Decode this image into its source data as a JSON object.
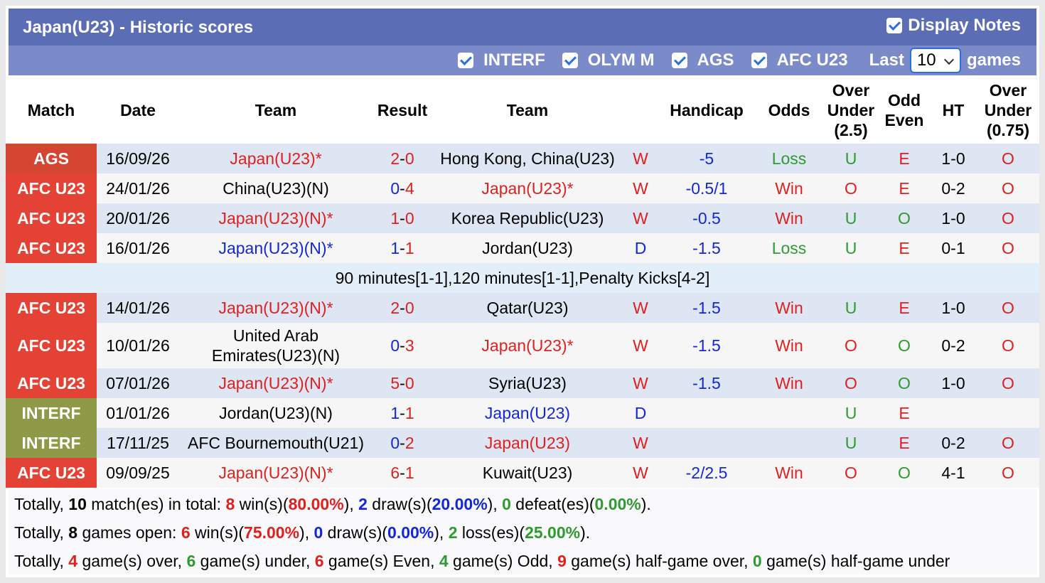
{
  "header": {
    "title": "Japan(U23) - Historic scores",
    "display_notes": "Display Notes",
    "filters": [
      "INTERF",
      "OLYM M",
      "AGS",
      "AFC U23"
    ],
    "last_label": "Last",
    "last_value": "10",
    "games_label": "games"
  },
  "columns": {
    "match": "Match",
    "date": "Date",
    "team1": "Team",
    "result": "Result",
    "team2": "Team",
    "handicap": "Handicap",
    "odds": "Odds",
    "ou_a": "Over",
    "ou_b": "Under",
    "ou_c": "(2.5)",
    "oe_a": "Odd",
    "oe_b": "Even",
    "ht": "HT",
    "ou2_a": "Over",
    "ou2_b": "Under",
    "ou2_c": "(0.75)"
  },
  "rows": [
    {
      "comp": "AGS",
      "date": "16/09/26",
      "home": "Japan(U23)*",
      "home_color": "red",
      "hs": "2",
      "as": "0",
      "hs_color": "red",
      "away": "Hong Kong, China(U23)",
      "away_color": "black",
      "res": "W",
      "hcp": "-5",
      "odds": "Loss",
      "odds_color": "green",
      "ou": "U",
      "ou_color": "green",
      "oe": "E",
      "oe_color": "red",
      "ht": "1-0",
      "ou2": "O"
    },
    {
      "comp": "AFC U23",
      "date": "24/01/26",
      "home": "China(U23)(N)",
      "home_color": "black",
      "hs": "0",
      "as": "4",
      "hs_color": "blue",
      "away": "Japan(U23)*",
      "away_color": "red",
      "res": "W",
      "hcp": "-0.5/1",
      "odds": "Win",
      "odds_color": "red",
      "ou": "O",
      "ou_color": "red",
      "oe": "E",
      "oe_color": "red",
      "ht": "0-2",
      "ou2": "O"
    },
    {
      "comp": "AFC U23",
      "date": "20/01/26",
      "home": "Japan(U23)(N)*",
      "home_color": "red",
      "hs": "1",
      "as": "0",
      "hs_color": "red",
      "away": "Korea Republic(U23)",
      "away_color": "black",
      "res": "W",
      "hcp": "-0.5",
      "odds": "Win",
      "odds_color": "red",
      "ou": "U",
      "ou_color": "green",
      "oe": "O",
      "oe_color": "green",
      "ht": "1-0",
      "ou2": "O"
    },
    {
      "comp": "AFC U23",
      "date": "16/01/26",
      "home": "Japan(U23)(N)*",
      "home_color": "blue",
      "hs": "1",
      "as": "1",
      "hs_color": "blue",
      "away": "Jordan(U23)",
      "away_color": "black",
      "res": "D",
      "hcp": "-1.5",
      "odds": "Loss",
      "odds_color": "green",
      "ou": "U",
      "ou_color": "green",
      "oe": "E",
      "oe_color": "red",
      "ht": "0-1",
      "ou2": "O"
    },
    {
      "comp": "AFC U23",
      "date": "14/01/26",
      "home": "Japan(U23)(N)*",
      "home_color": "red",
      "hs": "2",
      "as": "0",
      "hs_color": "red",
      "away": "Qatar(U23)",
      "away_color": "black",
      "res": "W",
      "hcp": "-1.5",
      "odds": "Win",
      "odds_color": "red",
      "ou": "U",
      "ou_color": "green",
      "oe": "E",
      "oe_color": "red",
      "ht": "1-0",
      "ou2": "O"
    },
    {
      "comp": "AFC U23",
      "date": "10/01/26",
      "home": "United Arab Emirates(U23)(N)",
      "home_color": "black",
      "hs": "0",
      "as": "3",
      "hs_color": "blue",
      "away": "Japan(U23)*",
      "away_color": "red",
      "res": "W",
      "hcp": "-1.5",
      "odds": "Win",
      "odds_color": "red",
      "ou": "O",
      "ou_color": "red",
      "oe": "O",
      "oe_color": "green",
      "ht": "0-2",
      "ou2": "O"
    },
    {
      "comp": "AFC U23",
      "date": "07/01/26",
      "home": "Japan(U23)(N)*",
      "home_color": "red",
      "hs": "5",
      "as": "0",
      "hs_color": "red",
      "away": "Syria(U23)",
      "away_color": "black",
      "res": "W",
      "hcp": "-1.5",
      "odds": "Win",
      "odds_color": "red",
      "ou": "O",
      "ou_color": "red",
      "oe": "O",
      "oe_color": "green",
      "ht": "1-0",
      "ou2": "O"
    },
    {
      "comp": "INTERF",
      "date": "01/01/26",
      "home": "Jordan(U23)(N)",
      "home_color": "black",
      "hs": "1",
      "as": "1",
      "hs_color": "blue",
      "away": "Japan(U23)",
      "away_color": "blue",
      "res": "D",
      "hcp": "",
      "odds": "",
      "odds_color": "red",
      "ou": "U",
      "ou_color": "green",
      "oe": "E",
      "oe_color": "red",
      "ht": "",
      "ou2": ""
    },
    {
      "comp": "INTERF",
      "date": "17/11/25",
      "home": "AFC Bournemouth(U21)",
      "home_color": "black",
      "hs": "0",
      "as": "2",
      "hs_color": "blue",
      "away": "Japan(U23)",
      "away_color": "red",
      "res": "W",
      "hcp": "",
      "odds": "",
      "odds_color": "red",
      "ou": "U",
      "ou_color": "green",
      "oe": "E",
      "oe_color": "red",
      "ht": "0-2",
      "ou2": "O"
    },
    {
      "comp": "AFC U23",
      "date": "09/09/25",
      "home": "Japan(U23)(N)*",
      "home_color": "red",
      "hs": "6",
      "as": "1",
      "hs_color": "red",
      "away": "Kuwait(U23)",
      "away_color": "black",
      "res": "W",
      "hcp": "-2/2.5",
      "odds": "Win",
      "odds_color": "red",
      "ou": "O",
      "ou_color": "red",
      "oe": "O",
      "oe_color": "green",
      "ht": "4-1",
      "ou2": "O"
    }
  ],
  "note_after_row_4": "90 minutes[1-1],120 minutes[1-1],Penalty Kicks[4-2]",
  "summary": {
    "l1": {
      "a": "Totally, ",
      "n1": "10",
      "b": " match(es) in total: ",
      "n2": "8",
      "c": " win(s)(",
      "p2": "80.00%",
      "d": "), ",
      "n3": "2",
      "e": " draw(s)(",
      "p3": "20.00%",
      "f": "), ",
      "n4": "0",
      "g": " defeat(es)(",
      "p4": "0.00%",
      "h": ")."
    },
    "l2": {
      "a": "Totally, ",
      "n1": "8",
      "b": " games open: ",
      "n2": "6",
      "c": " win(s)(",
      "p2": "75.00%",
      "d": "), ",
      "n3": "0",
      "e": " draw(s)(",
      "p3": "0.00%",
      "f": "), ",
      "n4": "2",
      "g": " loss(es)(",
      "p4": "25.00%",
      "h": ")."
    },
    "l3": {
      "a": "Totally, ",
      "n1": "4",
      "b": " game(s) over, ",
      "n2": "6",
      "c": " game(s) under, ",
      "n3": "6",
      "d": " game(s) Even, ",
      "n4": "4",
      "e": " game(s) Odd, ",
      "n5": "9",
      "f": " game(s) half-game over, ",
      "n6": "0",
      "g": " game(s) half-game under"
    }
  }
}
